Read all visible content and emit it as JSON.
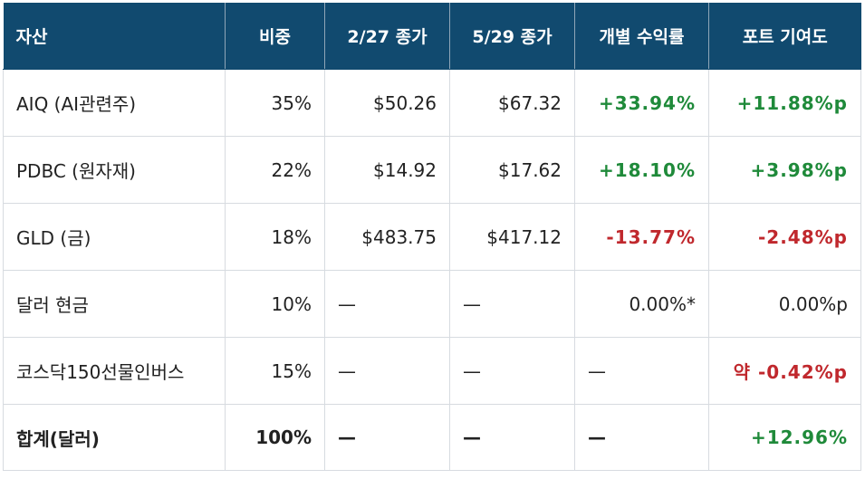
{
  "table": {
    "headers": [
      "자산",
      "비중",
      "2/27 종가",
      "5/29 종가",
      "개별 수익률",
      "포트 기여도"
    ],
    "rows": [
      {
        "asset": "AIQ (AI관련주)",
        "weight": "35%",
        "close_0227": "$50.26",
        "close_0529": "$67.32",
        "return": "+33.94%",
        "contribution": "+11.88%p"
      },
      {
        "asset": "PDBC (원자재)",
        "weight": "22%",
        "close_0227": "$14.92",
        "close_0529": "$17.62",
        "return": "+18.10%",
        "contribution": "+3.98%p"
      },
      {
        "asset": "GLD (금)",
        "weight": "18%",
        "close_0227": "$483.75",
        "close_0529": "$417.12",
        "return": "-13.77%",
        "contribution": "-2.48%p"
      },
      {
        "asset": "달러 현금",
        "weight": "10%",
        "close_0227": "—",
        "close_0529": "—",
        "return": "0.00%*",
        "contribution": "0.00%p"
      },
      {
        "asset": "코스닥150선물인버스",
        "weight": "15%",
        "close_0227": "—",
        "close_0529": "—",
        "return": "—",
        "contribution": "약 -0.42%p"
      }
    ],
    "total": {
      "asset": "합계(달러)",
      "weight": "100%",
      "close_0227": "—",
      "close_0529": "—",
      "return": "—",
      "contribution": "+12.96%"
    }
  },
  "colors": {
    "header_bg": "#114a6f",
    "positive": "#1f8a3a",
    "negative": "#c0282d",
    "border": "#d7dbe0"
  }
}
